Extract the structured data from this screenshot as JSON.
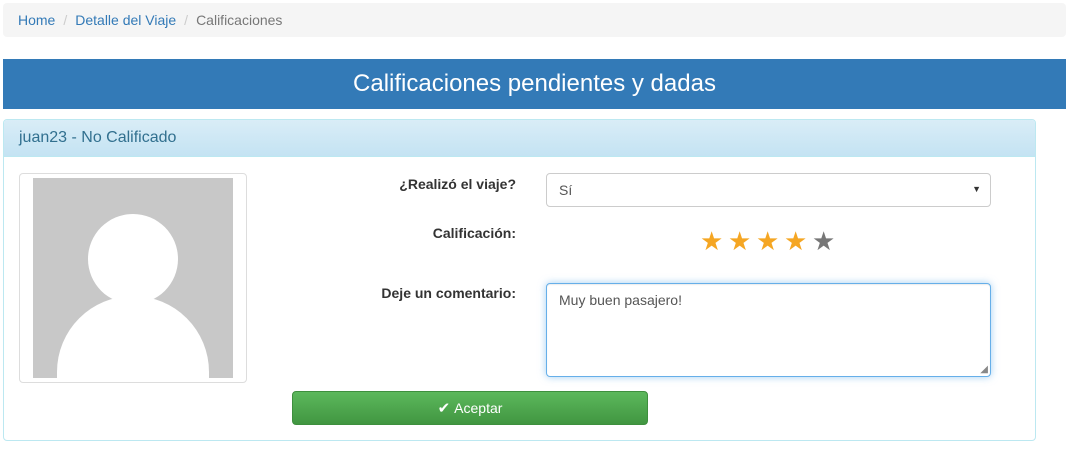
{
  "breadcrumb": {
    "items": [
      "Home",
      "Detalle del Viaje"
    ],
    "active": "Calificaciones"
  },
  "banner": {
    "title": "Calificaciones pendientes y dadas"
  },
  "panel": {
    "heading": "juan23 - No Calificado",
    "trip_label": "¿Realizó el viaje?",
    "trip_value": "Sí",
    "rating_label": "Calificación:",
    "rating_value": 4,
    "rating_max": 5,
    "comment_label": "Deje un comentario:",
    "comment_value": "Muy buen pasajero!",
    "submit_label": "Aceptar"
  },
  "icons": {
    "submit": "check-icon",
    "avatar": "user-silhouette-icon",
    "select": "caret-down-icon",
    "star": "star-icon"
  },
  "colors": {
    "primary": "#337ab7",
    "success": "#5cb85c",
    "star_on": "#f5a623",
    "star_off": "#777777",
    "info_text": "#31708f"
  }
}
